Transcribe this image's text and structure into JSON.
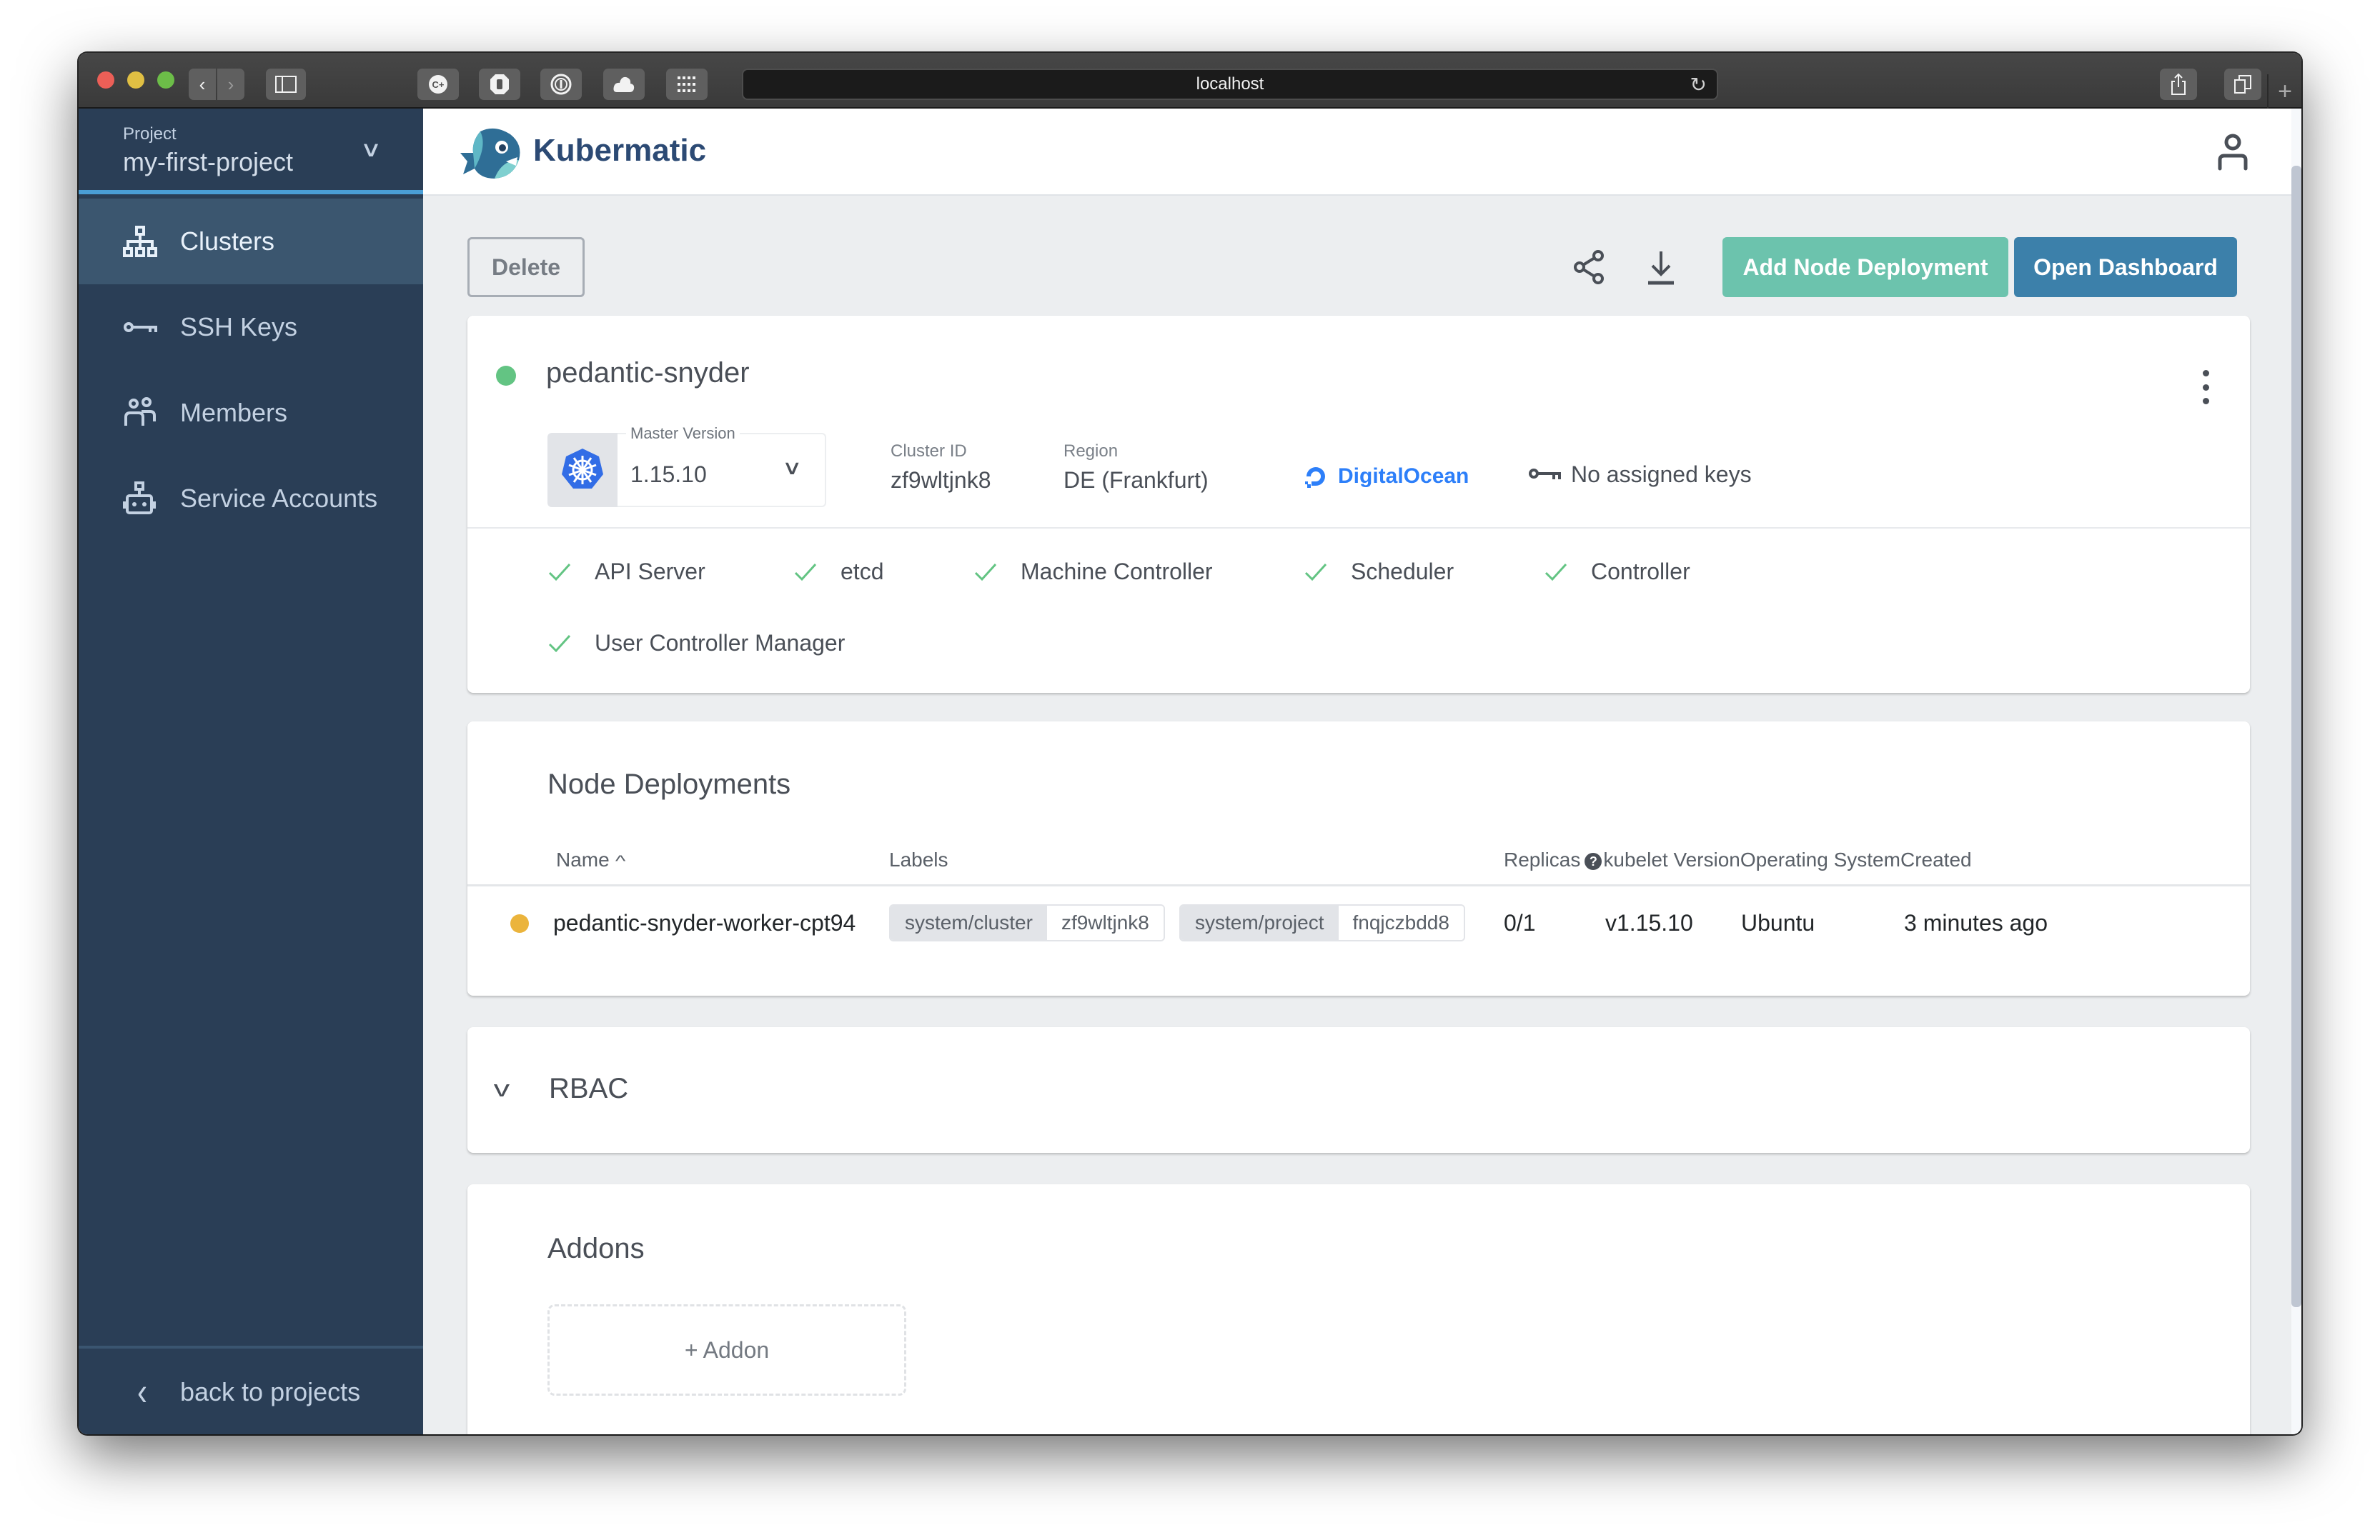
{
  "browser": {
    "url": "localhost",
    "buttons": {
      "back": "‹",
      "forward": "›",
      "new_tab": "+"
    },
    "extension_icons": [
      "cplus-icon",
      "adblock-hand-icon",
      "onepassword-icon",
      "cloud-icon",
      "grid-icon"
    ]
  },
  "sidebar": {
    "project_label": "Project",
    "project_name": "my-first-project",
    "items": [
      {
        "label": "Clusters",
        "icon": "clusters-icon",
        "active": true
      },
      {
        "label": "SSH Keys",
        "icon": "key-icon",
        "active": false
      },
      {
        "label": "Members",
        "icon": "members-icon",
        "active": false
      },
      {
        "label": "Service Accounts",
        "icon": "robot-icon",
        "active": false
      }
    ],
    "back_label": "back to projects"
  },
  "header": {
    "brand": "Kubermatic"
  },
  "toolbar": {
    "delete_label": "Delete",
    "add_node_deployment_label": "Add Node Deployment",
    "open_dashboard_label": "Open Dashboard"
  },
  "cluster": {
    "name": "pedantic-snyder",
    "status_color": "#63c483",
    "master_version_label": "Master Version",
    "master_version": "1.15.10",
    "cluster_id_label": "Cluster ID",
    "cluster_id": "zf9wltjnk8",
    "region_label": "Region",
    "region": "DE (Frankfurt)",
    "provider": "DigitalOcean",
    "provider_color": "#2d7ff9",
    "ssh_keys_text": "No assigned keys",
    "health": [
      {
        "label": "API Server",
        "ok": true
      },
      {
        "label": "etcd",
        "ok": true
      },
      {
        "label": "Machine Controller",
        "ok": true
      },
      {
        "label": "Scheduler",
        "ok": true
      },
      {
        "label": "Controller",
        "ok": true
      },
      {
        "label": "User Controller Manager",
        "ok": true
      }
    ]
  },
  "node_deployments": {
    "title": "Node Deployments",
    "columns": [
      "Name",
      "Labels",
      "Replicas",
      "kubelet Version",
      "Operating System",
      "Created"
    ],
    "sort_indicator": "^",
    "help_glyph": "?",
    "rows": [
      {
        "status_color": "#ebb43c",
        "name": "pedantic-snyder-worker-cpt94",
        "labels": [
          {
            "key": "system/cluster",
            "value": "zf9wltjnk8"
          },
          {
            "key": "system/project",
            "value": "fnqjczbdd8"
          }
        ],
        "replicas": "0/1",
        "kubelet_version": "v1.15.10",
        "os": "Ubuntu",
        "created": "3 minutes ago"
      }
    ]
  },
  "rbac": {
    "title": "RBAC",
    "expander": "v"
  },
  "addons": {
    "title": "Addons",
    "add_label": "+ Addon"
  }
}
